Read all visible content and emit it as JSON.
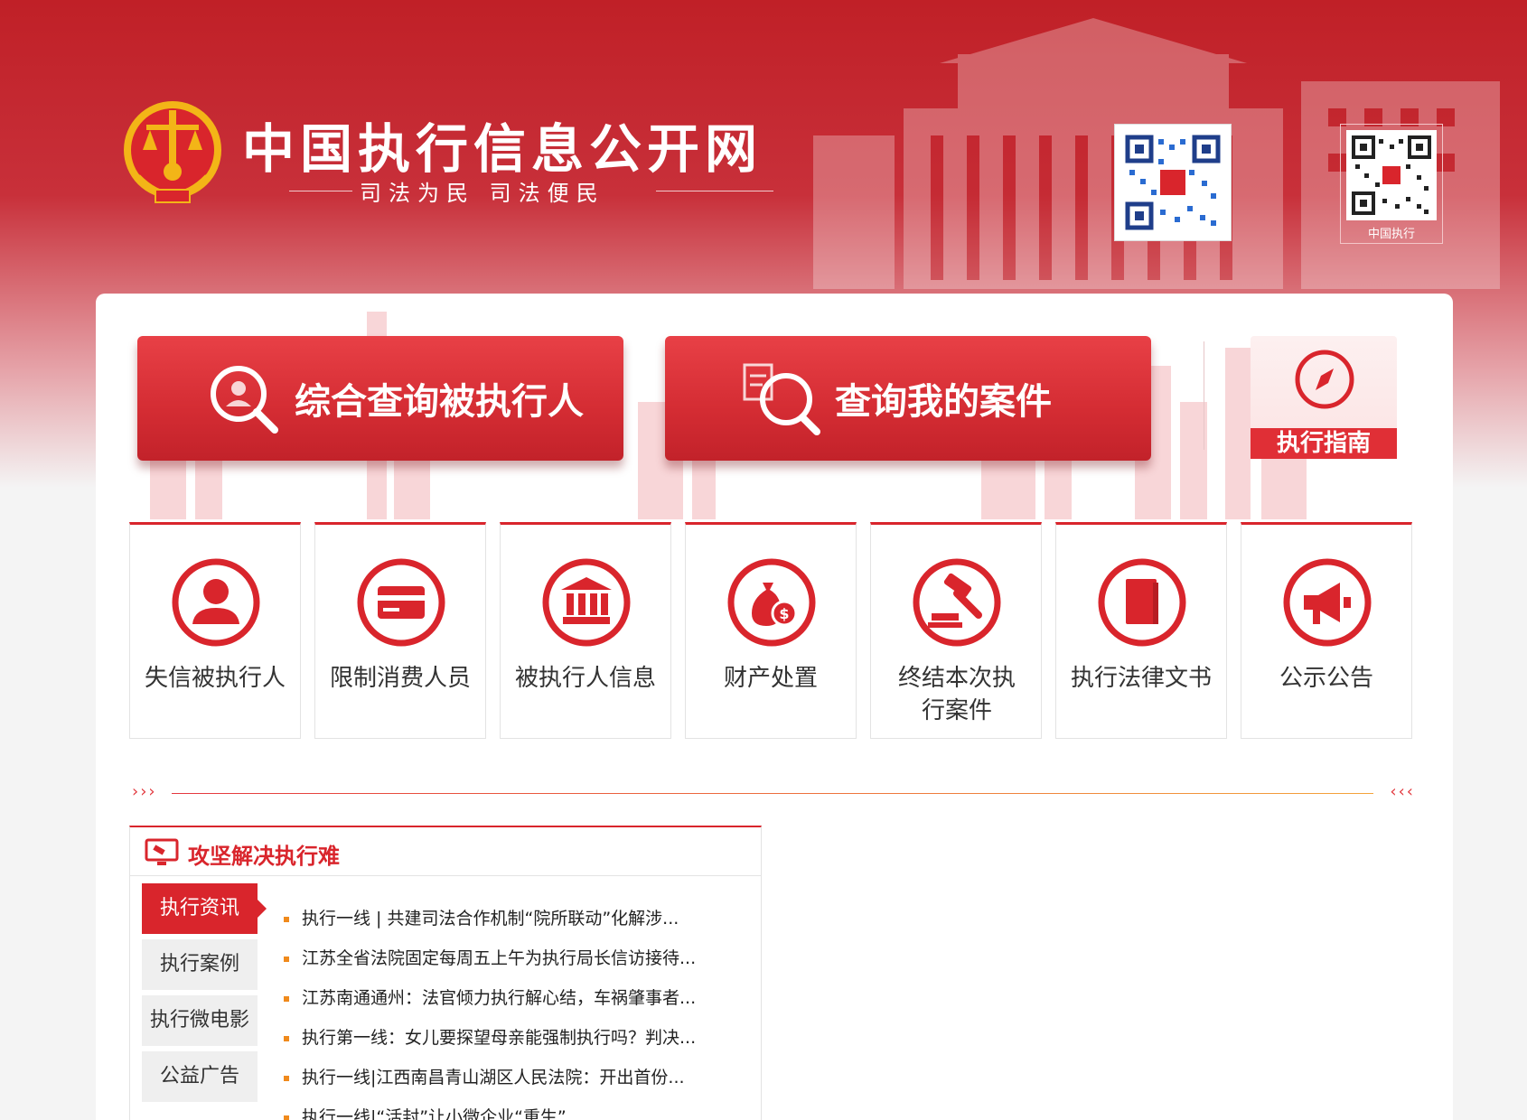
{
  "header": {
    "site_title": "中国执行信息公开网",
    "slogan": "司法为民  司法便民",
    "qr_app_caption": "中国执行"
  },
  "actions": {
    "query_executed": "综合查询被执行人",
    "query_mycase": "查询我的案件",
    "guide": "执行指南"
  },
  "categories": [
    {
      "label": "失信被执行人",
      "icon": "person-icon"
    },
    {
      "label": "限制消费人员",
      "icon": "card-icon"
    },
    {
      "label": "被执行人信息",
      "icon": "court-building-icon"
    },
    {
      "label": "财产处置",
      "icon": "money-bag-icon"
    },
    {
      "label": "终结本次执行案件",
      "icon": "gavel-icon"
    },
    {
      "label": "执行法律文书",
      "icon": "book-icon"
    },
    {
      "label": "公示公告",
      "icon": "megaphone-icon"
    }
  ],
  "divider": {
    "left_arrows": "›››",
    "right_arrows": "‹‹‹"
  },
  "news": {
    "title": "攻坚解决执行难",
    "tabs": [
      "执行资讯",
      "执行案例",
      "执行微电影",
      "公益广告"
    ],
    "active_tab": 0,
    "items": [
      "执行一线 | 共建司法合作机制“院所联动”化解涉...",
      "江苏全省法院固定每周五上午为执行局长信访接待...",
      "江苏南通通州：法官倾力执行解心结，车祸肇事者...",
      "执行第一线：女儿要探望母亲能强制执行吗？判决...",
      "执行一线|江西南昌青山湖区人民法院：开出首份...",
      "执行一线|“活封”让小微企业“重生”"
    ]
  },
  "colors": {
    "brand_red": "#d9252c",
    "accent_orange": "#f08a1c"
  }
}
